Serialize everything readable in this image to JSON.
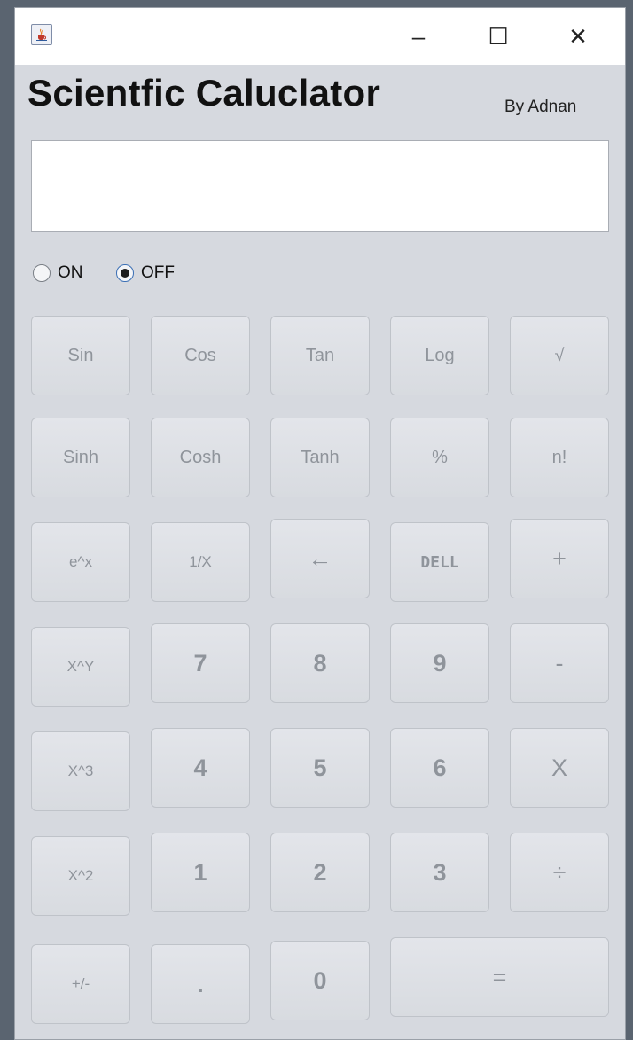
{
  "window": {
    "icon": "java-coffee-icon",
    "controls": {
      "minimize": "–",
      "maximize": "☐",
      "close": "✕"
    }
  },
  "app": {
    "title": "Scientfic Caluclator",
    "author": "By Adnan"
  },
  "display": {
    "value": ""
  },
  "power": {
    "on_label": "ON",
    "off_label": "OFF",
    "selected": "OFF"
  },
  "keys": [
    "Sin",
    "Cos",
    "Tan",
    "Log",
    "√",
    "Sinh",
    "Cosh",
    "Tanh",
    "%",
    "n!",
    "e^x",
    "1/X",
    "←",
    "DELL",
    "+",
    "X^Y",
    "7",
    "8",
    "9",
    "-",
    "X^3",
    "4",
    "5",
    "6",
    "X",
    "X^2",
    "1",
    "2",
    "3",
    "÷",
    "+/-",
    ".",
    "0",
    "="
  ]
}
